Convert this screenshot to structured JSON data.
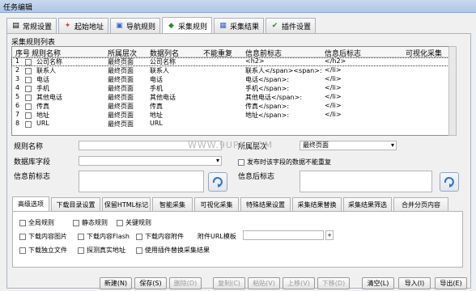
{
  "window": {
    "title": "任务编辑"
  },
  "tabs": [
    {
      "label": "常规设置",
      "icon": "settings-icon"
    },
    {
      "label": "起始地址",
      "icon": "start-address-icon"
    },
    {
      "label": "导航规则",
      "icon": "navigation-icon"
    },
    {
      "label": "采集规则",
      "icon": "collect-rule-icon"
    },
    {
      "label": "采集结果",
      "icon": "result-icon"
    },
    {
      "label": "插件设置",
      "icon": "plugin-icon"
    }
  ],
  "rules": {
    "section_label": "采集规则列表",
    "columns": [
      "序号",
      "规则名称",
      "所属层次",
      "数据列名",
      "不能重复",
      "信息前标志",
      "信息后标志",
      "可视化采集"
    ],
    "rows": [
      {
        "no": "1",
        "name": "公司名称",
        "level": "最终页面",
        "col": "公司名称",
        "dup": "",
        "before": "<h2>",
        "after": "</h2>",
        "visual": ""
      },
      {
        "no": "2",
        "name": "联系人",
        "level": "最终页面",
        "col": "联系人",
        "dup": "",
        "before": "联系人</span><span>:",
        "after": "</li>",
        "visual": ""
      },
      {
        "no": "3",
        "name": "电话",
        "level": "最终页面",
        "col": "电话",
        "dup": "",
        "before": "电话</span>:",
        "after": "</li>",
        "visual": ""
      },
      {
        "no": "4",
        "name": "手机",
        "level": "最终页面",
        "col": "手机",
        "dup": "",
        "before": "手机</span>:",
        "after": "</li>",
        "visual": ""
      },
      {
        "no": "5",
        "name": "其他电话",
        "level": "最终页面",
        "col": "其他电话",
        "dup": "",
        "before": "其他电话</span>:",
        "after": "</li>",
        "visual": ""
      },
      {
        "no": "6",
        "name": "传真",
        "level": "最终页面",
        "col": "传真",
        "dup": "",
        "before": "传真</span>:",
        "after": "</li>",
        "visual": ""
      },
      {
        "no": "7",
        "name": "地址",
        "level": "最终页面",
        "col": "地址",
        "dup": "",
        "before": "地址</span>:",
        "after": "</li>",
        "visual": ""
      },
      {
        "no": "8",
        "name": "URL",
        "level": "最终页面",
        "col": "URL",
        "dup": "",
        "before": "",
        "after": "",
        "visual": ""
      }
    ]
  },
  "form": {
    "rule_name_label": "规则名称",
    "rule_name_value": "",
    "level_label": "所属层次",
    "level_value": "最终页面",
    "db_field_label": "数据库字段",
    "db_field_value": "",
    "no_repeat_label": "发布时该字段的数据不能重复",
    "before_label": "信息前标志",
    "after_label": "信息后标志"
  },
  "watermark": "WWW.9UPK.COM",
  "subtabs": [
    "高级选项",
    "下载目录设置",
    "保留HTML标记",
    "智能采集",
    "可视化采集",
    "特殊结果设置",
    "采集结果替换",
    "采集结果筛选",
    "合并分页内容"
  ],
  "options": {
    "row1": [
      "全局规则",
      "静态规则",
      "关键规则"
    ],
    "row2": [
      "下载内容图片",
      "下载内容Flash",
      "下载内容附件"
    ],
    "attach_template_label": "附件URL模板",
    "row3": [
      "下载独立文件",
      "探测真实地址",
      "使用插件替换采集结果"
    ]
  },
  "buttons": {
    "new": "新建(N)",
    "save": "保存(S)",
    "delete": "删除(D)",
    "copy": "复制(C)",
    "paste": "粘贴(V)",
    "up": "上移(V)",
    "down": "下移(D)",
    "clear": "清空(L)",
    "import": "导入(I)",
    "export": "导出(E)"
  }
}
